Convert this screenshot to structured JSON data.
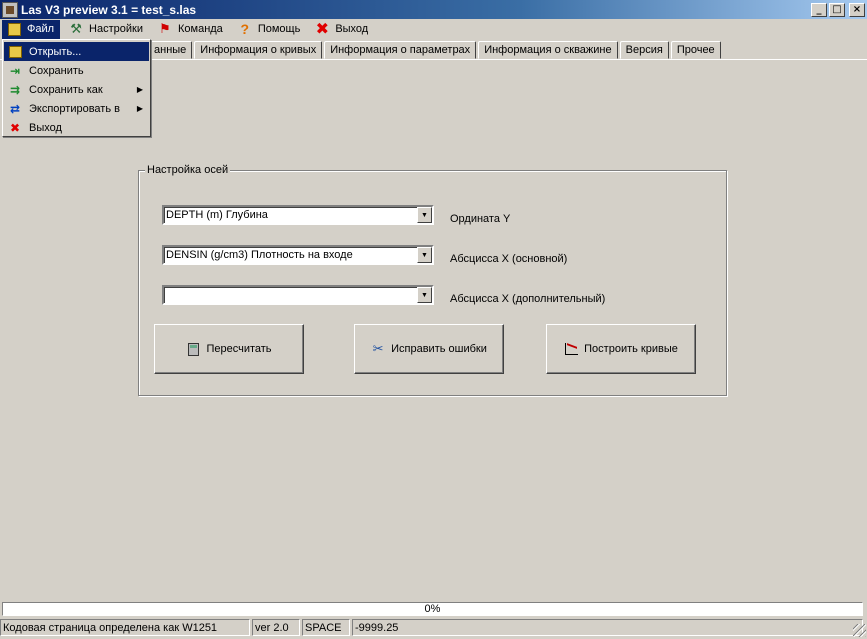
{
  "window": {
    "title": "Las V3 preview 3.1 = test_s.las",
    "btn_min": "_",
    "btn_max": "□",
    "btn_close": "×"
  },
  "menu": {
    "file": "Файл",
    "settings": "Настройки",
    "command": "Команда",
    "help": "Помощь",
    "exit": "Выход"
  },
  "tabs": [
    "анные",
    "Информация о кривых",
    "Информация о параметрах",
    "Информация о скважине",
    "Версия",
    "Прочее"
  ],
  "file_menu": {
    "open": "Открыть...",
    "save": "Сохранить",
    "save_as": "Сохранить как",
    "export": "Экспортировать в",
    "exit": "Выход",
    "submenu_arrow": "▶"
  },
  "axes": {
    "legend": "Настройка осей",
    "y_value": "DEPTH (m) Глубина",
    "y_label": "Ордината Y",
    "x_main_value": "DENSIN (g/cm3) Плотность на входе",
    "x_main_label": "Абсцисса X (основной)",
    "x_extra_value": "",
    "x_extra_label": "Абсцисса X (дополнительный)",
    "combo_arrow": "▼"
  },
  "buttons": {
    "recalc": "Пересчитать",
    "fix_errors": "Исправить ошибки",
    "build_curves": "Построить кривые"
  },
  "progress": {
    "text": "0%",
    "value": 0
  },
  "status": {
    "codepage": "Кодовая страница определена как W1251",
    "version": "ver 2.0",
    "delimiter": "SPACE",
    "null_value": "-9999.25"
  }
}
